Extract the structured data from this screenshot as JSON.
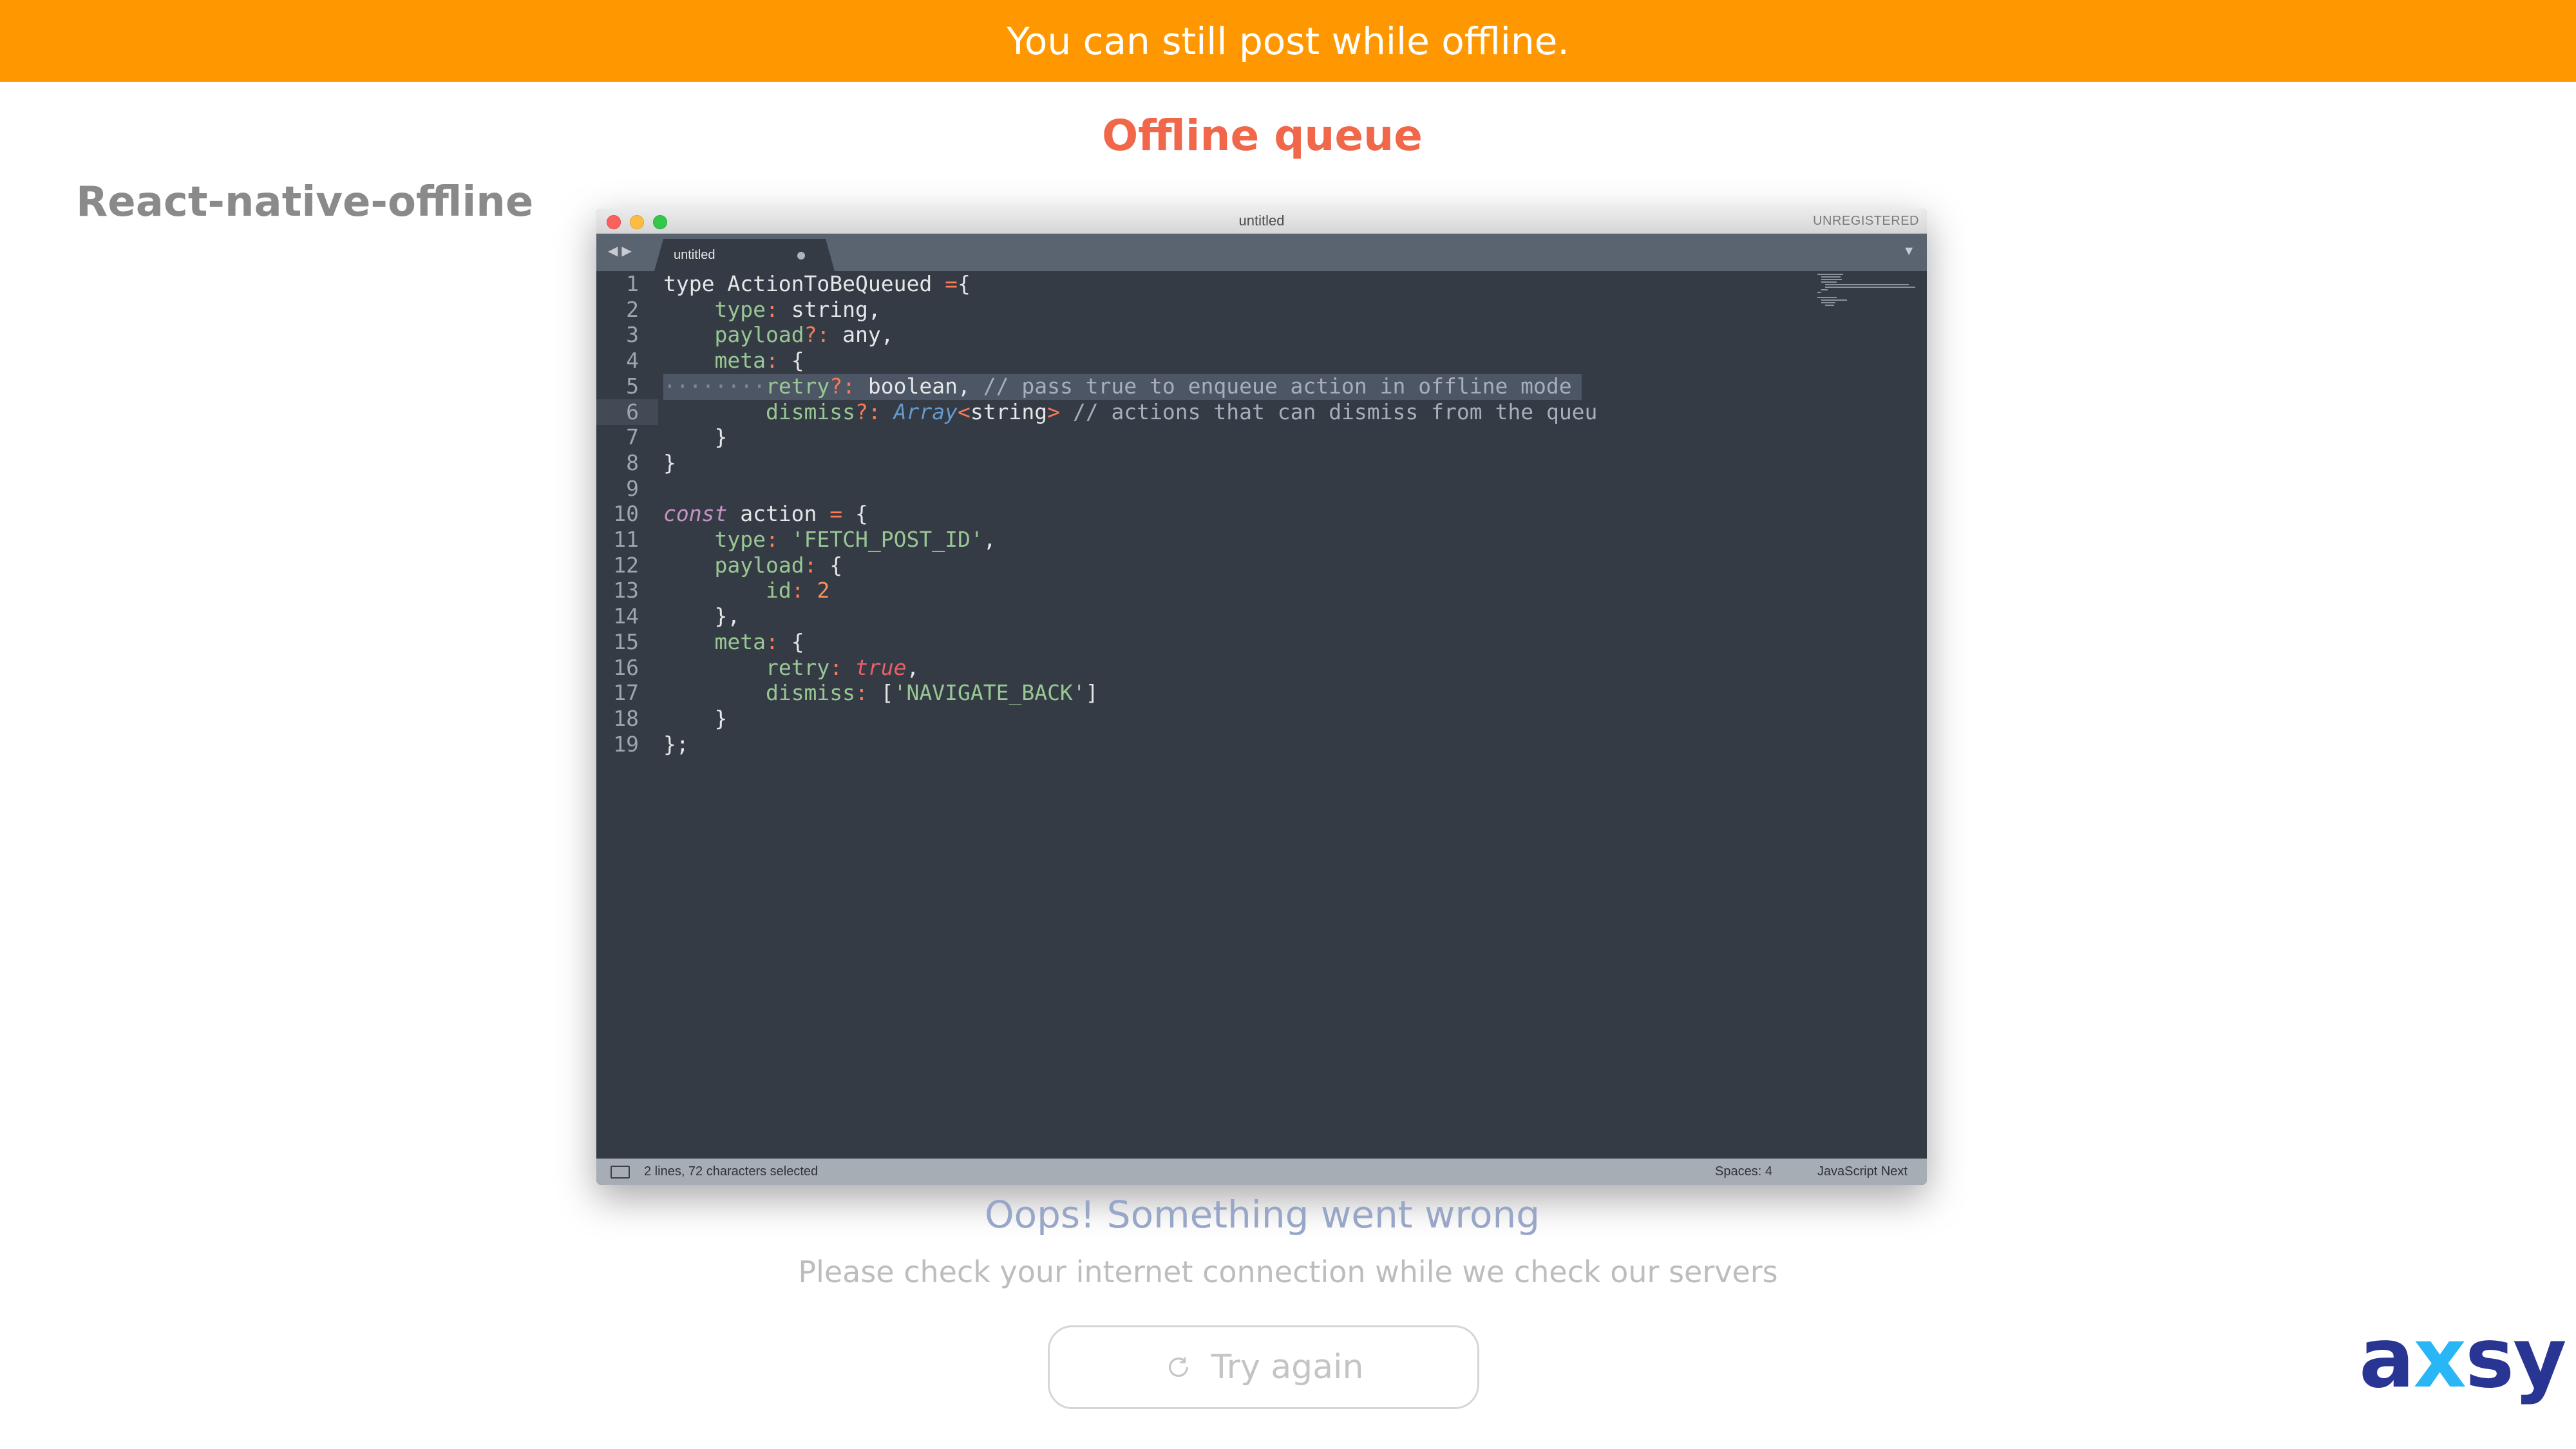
{
  "banner": {
    "text": "You can still post while offline."
  },
  "slide": {
    "title": "Offline queue",
    "side_title": "React-native-offline"
  },
  "editor": {
    "window_title": "untitled",
    "registration": "UNREGISTERED",
    "tab_label": "untitled",
    "line_numbers": [
      "1",
      "2",
      "3",
      "4",
      "5",
      "6",
      "7",
      "8",
      "9",
      "10",
      "11",
      "12",
      "13",
      "14",
      "15",
      "16",
      "17",
      "18",
      "19"
    ],
    "lines": [
      [
        [
          "",
          "type ActionToBeQueued "
        ],
        [
          "op",
          "="
        ],
        [
          "",
          "{"
        ]
      ],
      [
        [
          "",
          "    "
        ],
        [
          "prop",
          "type"
        ],
        [
          "op",
          ":"
        ],
        [
          "",
          " string,"
        ]
      ],
      [
        [
          "",
          "    "
        ],
        [
          "prop",
          "payload"
        ],
        [
          "op",
          "?:"
        ],
        [
          "",
          " any,"
        ]
      ],
      [
        [
          "",
          "    "
        ],
        [
          "prop",
          "meta"
        ],
        [
          "op",
          ":"
        ],
        [
          "",
          " {"
        ]
      ],
      [
        [
          "dots",
          "········"
        ],
        [
          "prop",
          "retry"
        ],
        [
          "op",
          "?:"
        ],
        [
          "",
          " boolean, "
        ],
        [
          "cmt",
          "// pass true to enqueue action in offline mode"
        ]
      ],
      [
        [
          "",
          "        "
        ],
        [
          "prop",
          "dismiss"
        ],
        [
          "op",
          "?:"
        ],
        [
          "",
          " "
        ],
        [
          "cls",
          "Array"
        ],
        [
          "op",
          "<"
        ],
        [
          "",
          "string"
        ],
        [
          "op",
          ">"
        ],
        [
          "",
          " "
        ],
        [
          "cmt",
          "// actions that can dismiss from the queu"
        ]
      ],
      [
        [
          "",
          "    }"
        ]
      ],
      [
        [
          "",
          "}"
        ]
      ],
      [
        [
          "",
          ""
        ]
      ],
      [
        [
          "kw",
          "const"
        ],
        [
          "",
          " action "
        ],
        [
          "op",
          "="
        ],
        [
          "",
          " {"
        ]
      ],
      [
        [
          "",
          "    "
        ],
        [
          "prop",
          "type"
        ],
        [
          "op",
          ":"
        ],
        [
          "",
          " "
        ],
        [
          "str",
          "'FETCH_POST_ID'"
        ],
        [
          "",
          ","
        ]
      ],
      [
        [
          "",
          "    "
        ],
        [
          "prop",
          "payload"
        ],
        [
          "op",
          ":"
        ],
        [
          "",
          " {"
        ]
      ],
      [
        [
          "",
          "        "
        ],
        [
          "prop",
          "id"
        ],
        [
          "op",
          ":"
        ],
        [
          "",
          " "
        ],
        [
          "num",
          "2"
        ]
      ],
      [
        [
          "",
          "    },"
        ]
      ],
      [
        [
          "",
          "    "
        ],
        [
          "prop",
          "meta"
        ],
        [
          "op",
          ":"
        ],
        [
          "",
          " {"
        ]
      ],
      [
        [
          "",
          "        "
        ],
        [
          "prop",
          "retry"
        ],
        [
          "op",
          ":"
        ],
        [
          "",
          " "
        ],
        [
          "boo",
          "true"
        ],
        [
          "",
          ","
        ]
      ],
      [
        [
          "",
          "        "
        ],
        [
          "prop",
          "dismiss"
        ],
        [
          "op",
          ":"
        ],
        [
          "",
          " ["
        ],
        [
          "str",
          "'NAVIGATE_BACK'"
        ],
        [
          "",
          "]"
        ]
      ],
      [
        [
          "",
          "    }"
        ]
      ],
      [
        [
          "",
          "};"
        ]
      ]
    ],
    "status_selection": "2 lines, 72 characters selected",
    "status_spaces": "Spaces: 4",
    "status_syntax": "JavaScript Next"
  },
  "offline": {
    "title": "Oops! Something went wrong",
    "message": "Please check your internet connection while we check our servers",
    "retry_label": "Try again"
  },
  "logo": {
    "a": "a",
    "x": "x",
    "sy": "sy"
  },
  "colors": {
    "banner": "#ff9800",
    "title": "#f0674a",
    "editor_bg": "#343b45",
    "logo": "#283593",
    "logo_accent": "#29b6f6"
  }
}
